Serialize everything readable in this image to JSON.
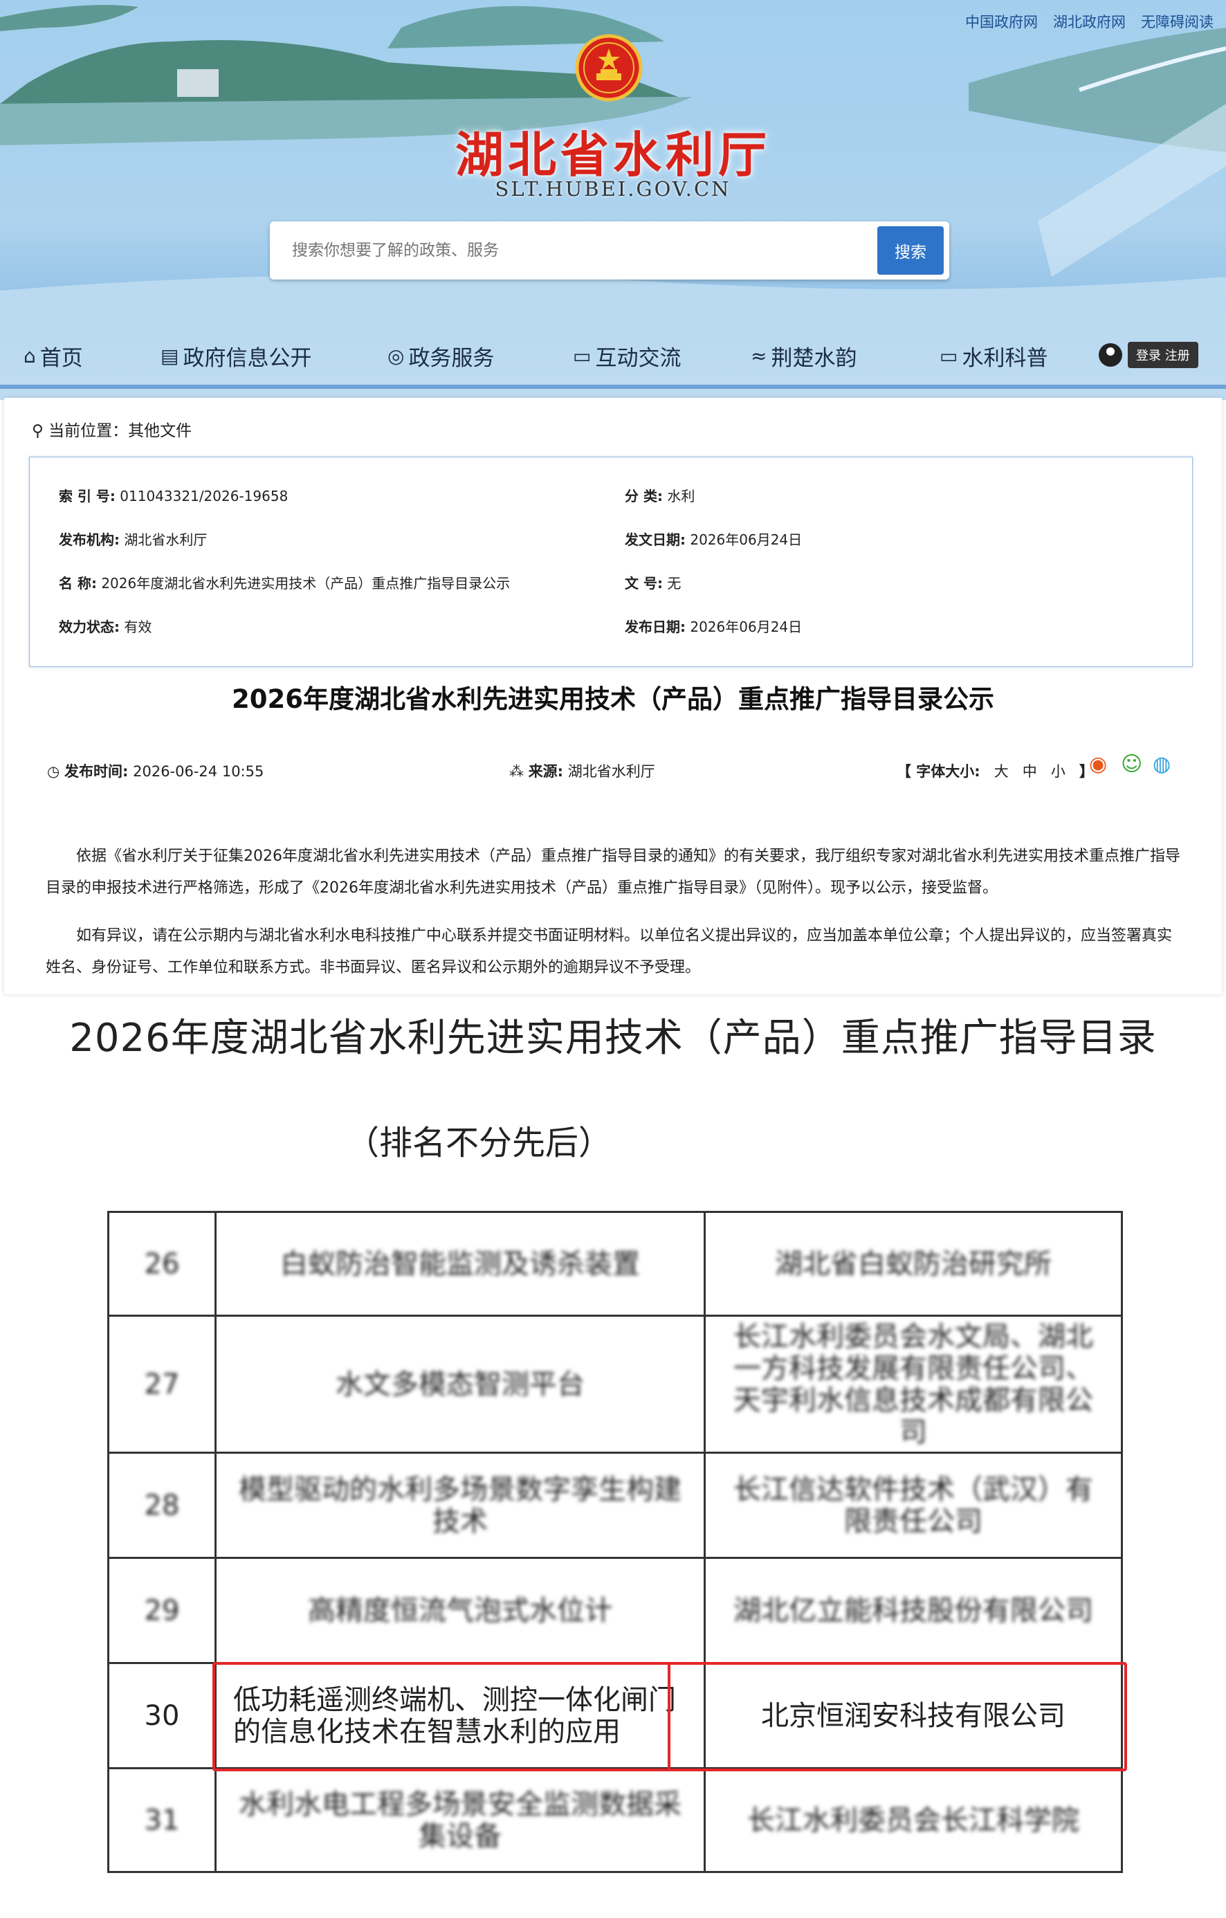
{
  "top_links": [
    "中国政府网",
    "湖北政府网",
    "无障碍阅读"
  ],
  "site": {
    "title": "湖北省水利厅",
    "domain": "SLT.HUBEI.GOV.CN"
  },
  "search": {
    "placeholder": "搜索你想要了解的政策、服务",
    "button": "搜索"
  },
  "nav": [
    {
      "label": "首页",
      "icon": "home-icon"
    },
    {
      "label": "政府信息公开",
      "icon": "document-icon"
    },
    {
      "label": "政务服务",
      "icon": "service-icon"
    },
    {
      "label": "互动交流",
      "icon": "chat-icon"
    },
    {
      "label": "荆楚水韵",
      "icon": "wave-icon"
    },
    {
      "label": "水利科普",
      "icon": "science-icon"
    }
  ],
  "login": {
    "label": "登录 注册"
  },
  "breadcrumb": {
    "label": "当前位置：",
    "value": "其他文件"
  },
  "meta": {
    "index_label": "索 引 号:",
    "index_value": "011043321/2026-19658",
    "category_label": "分 类:",
    "category_value": "水利",
    "publisher_label": "发布机构:",
    "publisher_value": "湖北省水利厅",
    "issue_date_label": "发文日期:",
    "issue_date_value": "2026年06月24日",
    "name_label": "名 称:",
    "name_value": "2026年度湖北省水利先进实用技术（产品）重点推广指导目录公示",
    "doc_no_label": "文 号:",
    "doc_no_value": "无",
    "status_label": "效力状态:",
    "status_value": "有效",
    "pub_date_label": "发布日期:",
    "pub_date_value": "2026年06月24日"
  },
  "article": {
    "title": "2026年度湖北省水利先进实用技术（产品）重点推广指导目录公示",
    "publish_time_label": "发布时间:",
    "publish_time": "2026-06-24 10:55",
    "source_label": "来源:",
    "source": "湖北省水利厅",
    "font_size_label": "【 字体大小:",
    "font_large": "大",
    "font_medium": "中",
    "font_small": "小",
    "font_close": "】",
    "paragraph1": "依据《省水利厅关于征集2026年度湖北省水利先进实用技术（产品）重点推广指导目录的通知》的有关要求，我厅组织专家对湖北省水利先进实用技术重点推广指导目录的申报技术进行严格筛选，形成了《2026年度湖北省水利先进实用技术（产品）重点推广指导目录》（见附件）。现予以公示，接受监督。",
    "paragraph2": "如有异议，请在公示期内与湖北省水利水电科技推广中心联系并提交书面证明材料。以单位名义提出异议的，应当加盖本单位公章；个人提出异议的，应当签署真实姓名、身份证号、工作单位和联系方式。非书面异议、匿名异议和公示期外的逾期异议不予受理。"
  },
  "directory": {
    "title": "2026年度湖北省水利先进实用技术（产品）重点推广指导目录",
    "subtitle": "（排名不分先后）",
    "rows": [
      {
        "no": "26",
        "tech": "白蚁防治智能监测及诱杀装置",
        "org": "湖北省白蚁防治研究所"
      },
      {
        "no": "27",
        "tech": "水文多模态智测平台",
        "org": "长江水利委员会水文局、湖北一方科技发展有限责任公司、天宇利水信息技术成都有限公司"
      },
      {
        "no": "28",
        "tech": "模型驱动的水利多场景数字孪生构建技术",
        "org": "长江信达软件技术（武汉）有限责任公司"
      },
      {
        "no": "29",
        "tech": "高精度恒流气泡式水位计",
        "org": "湖北亿立能科技股份有限公司"
      },
      {
        "no": "30",
        "tech": "低功耗遥测终端机、测控一体化闸门的信息化技术在智慧水利的应用",
        "org": "北京恒润安科技有限公司"
      },
      {
        "no": "31",
        "tech": "水利水电工程多场景安全监测数据采集设备",
        "org": "长江水利委员会长江科学院"
      }
    ]
  }
}
